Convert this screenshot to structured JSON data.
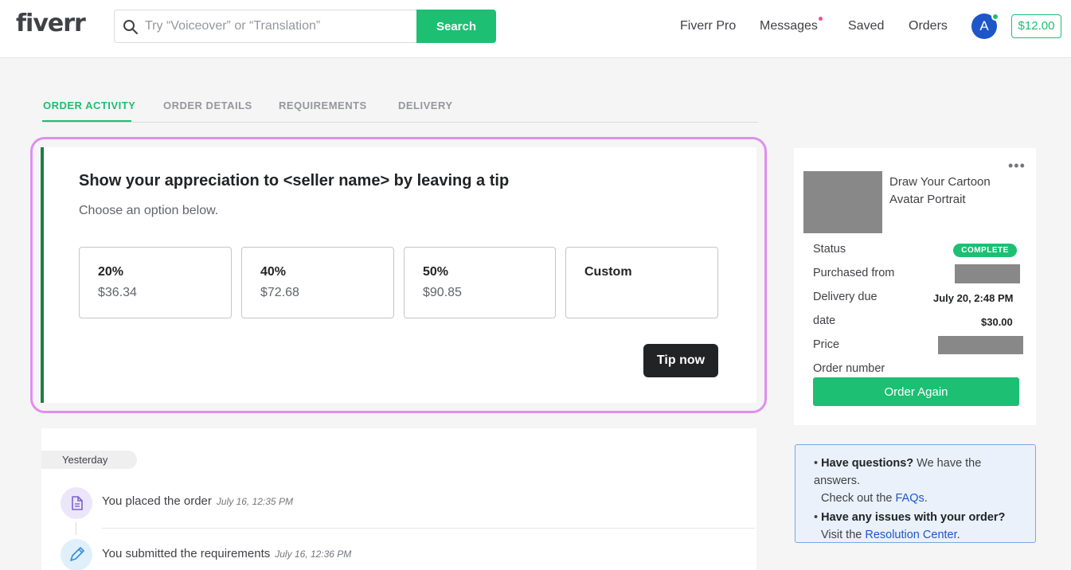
{
  "header": {
    "logo": "fiverr",
    "search_placeholder": "Try “Voiceover” or “Translation”",
    "search_button": "Search",
    "nav": [
      "Fiverr Pro",
      "Messages",
      "Saved",
      "Orders"
    ],
    "avatar_initial": "A",
    "balance": "$12.00"
  },
  "tabs": [
    "ORDER ACTIVITY",
    "ORDER DETAILS",
    "REQUIREMENTS",
    "DELIVERY"
  ],
  "tip": {
    "title": "Show your appreciation to <seller name> by leaving a tip",
    "subtitle": "Choose an option below.",
    "options": [
      {
        "label": "20%",
        "amount": "$36.34"
      },
      {
        "label": "40%",
        "amount": "$72.68"
      },
      {
        "label": "50%",
        "amount": "$90.85"
      },
      {
        "label": "Custom",
        "amount": ""
      }
    ],
    "button": "Tip now"
  },
  "activity": {
    "day": "Yesterday",
    "items": [
      {
        "text": "You placed the order",
        "time": "July 16, 12:35 PM"
      },
      {
        "text": "You submitted the requirements",
        "time": "July 16, 12:36 PM"
      }
    ]
  },
  "order": {
    "gig_title": "Draw Your Cartoon Avatar Portrait",
    "labels": [
      "Status",
      "Purchased from",
      "Delivery due",
      "date",
      "Price",
      "Order number"
    ],
    "status_badge": "COMPLETE",
    "delivery_due": "July 20, 2:48 PM",
    "price": "$30.00",
    "button": "Order Again"
  },
  "help": {
    "q1_bold": "Have questions?",
    "q1_rest": " We have the",
    "q1_line2": "answers.",
    "q1_line3_pre": "Check out the ",
    "q1_link": "FAQs",
    "q1_line3_post": ".",
    "q2_bold": "Have any issues with your order?",
    "q2_line2_pre": "Visit the ",
    "q2_link": "Resolution Center",
    "q2_line2_post": "."
  },
  "colors": {
    "brand_green": "#1dbf73",
    "highlight": "#e08ef0",
    "dark": "#222325"
  }
}
